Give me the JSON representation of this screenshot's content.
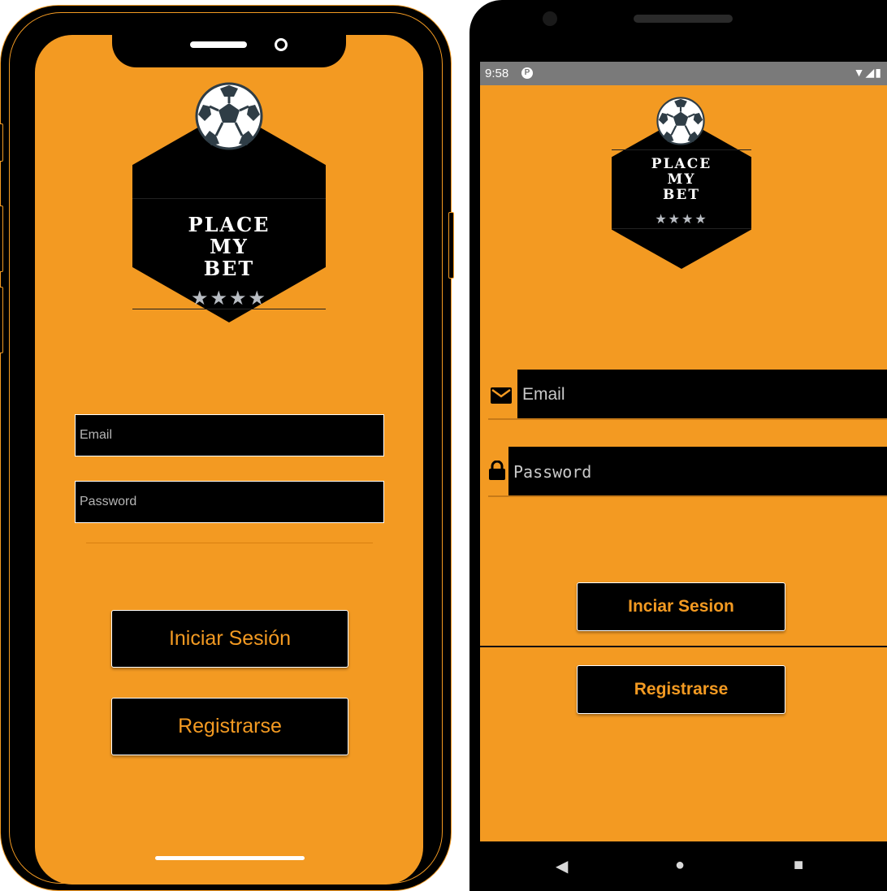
{
  "ios": {
    "logo": {
      "line1": "PLACE",
      "line2": "MY",
      "line3": "BET",
      "stars": "★★★★"
    },
    "email_placeholder": "Email",
    "password_placeholder": "Password",
    "login_label": "Iniciar Sesión",
    "register_label": "Registrarse"
  },
  "android": {
    "status": {
      "time": "9:58",
      "app_icon": "P",
      "sys_icons": "▼◢▮"
    },
    "logo": {
      "line1": "PLACE",
      "line2": "MY",
      "line3": "BET",
      "stars": "★★★★"
    },
    "email_icon": "mail-icon",
    "email_placeholder": "Email",
    "password_icon": "lock-icon",
    "password_placeholder": "Password",
    "login_label": "Inciar Sesion",
    "register_label": "Registrarse",
    "nav": {
      "back": "◀",
      "home": "●",
      "recents": "■"
    }
  },
  "colors": {
    "accent": "#f39a22",
    "panel": "#000000",
    "status_bar": "#7a7a7a"
  }
}
